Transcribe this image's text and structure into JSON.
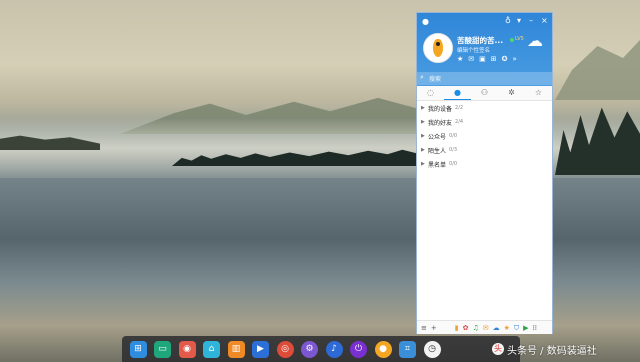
{
  "qq_panel": {
    "app_icon": "qq-penguin-icon",
    "window_controls": [
      {
        "icon": "skin-icon",
        "glyph": "♁"
      },
      {
        "icon": "dropdown-icon",
        "glyph": "▾"
      },
      {
        "icon": "minimize-icon",
        "glyph": "–"
      },
      {
        "icon": "close-icon",
        "glyph": "×"
      }
    ],
    "nickname": "苦酸甜的苦...",
    "level_badge": "LV5",
    "signature": "编辑个性签名",
    "header_icons": [
      {
        "icon": "favorite-icon",
        "glyph": "★"
      },
      {
        "icon": "mail-icon",
        "glyph": "✉"
      },
      {
        "icon": "wallet-icon",
        "glyph": "▣"
      },
      {
        "icon": "bag-icon",
        "glyph": "⊞"
      },
      {
        "icon": "star-icon",
        "glyph": "✪"
      },
      {
        "icon": "more-icon",
        "glyph": "»"
      }
    ],
    "weather_icon": "weather-cloudy-icon",
    "search": {
      "placeholder": "搜索",
      "icon": "search-icon"
    },
    "tabs": [
      {
        "icon": "message-icon",
        "glyph": "◌",
        "active": false
      },
      {
        "icon": "contacts-icon",
        "glyph": "●",
        "active": true
      },
      {
        "icon": "group-icon",
        "glyph": "⚇",
        "active": false
      },
      {
        "icon": "app-icon",
        "glyph": "✲",
        "active": false
      },
      {
        "icon": "favorites-icon",
        "glyph": "☆",
        "active": false
      }
    ],
    "groups": [
      {
        "name": "我的设备",
        "count": "2/2"
      },
      {
        "name": "我的好友",
        "count": "2/4"
      },
      {
        "name": "公众号",
        "count": "0/0"
      },
      {
        "name": "陌生人",
        "count": "0/3"
      },
      {
        "name": "黑名单",
        "count": "0/0"
      }
    ],
    "footer_icons": [
      {
        "icon": "menu-icon",
        "glyph": "≡",
        "color": "#555555"
      },
      {
        "icon": "add-icon",
        "glyph": "+",
        "color": "#555555"
      },
      {
        "icon": "file-icon",
        "glyph": "▮",
        "color": "#e8a23b"
      },
      {
        "icon": "game-icon",
        "glyph": "✿",
        "color": "#d94a4a"
      },
      {
        "icon": "music-icon",
        "glyph": "♫",
        "color": "#2aa14a"
      },
      {
        "icon": "mail-icon",
        "glyph": "✉",
        "color": "#e8a23b"
      },
      {
        "icon": "weiyun-icon",
        "glyph": "☁",
        "color": "#2f86d8"
      },
      {
        "icon": "qzone-icon",
        "glyph": "★",
        "color": "#e8a23b"
      },
      {
        "icon": "shield-icon",
        "glyph": "⛉",
        "color": "#2f86d8"
      },
      {
        "icon": "video-icon",
        "glyph": "▶",
        "color": "#2aa14a"
      },
      {
        "icon": "grid-icon",
        "glyph": "⁞⁞",
        "color": "#555555"
      }
    ]
  },
  "dock": {
    "apps": [
      {
        "icon": "launcher-icon",
        "glyph": "⊞",
        "color": "#2f8de0",
        "round": false
      },
      {
        "icon": "terminal-icon",
        "glyph": "▭",
        "color": "#1fa67a",
        "round": false
      },
      {
        "icon": "camera-icon",
        "glyph": "◉",
        "color": "#e35a4a",
        "round": false
      },
      {
        "icon": "store-icon",
        "glyph": "⌂",
        "color": "#2fb5d9",
        "round": false
      },
      {
        "icon": "files-icon",
        "glyph": "▥",
        "color": "#f08a24",
        "round": false
      },
      {
        "icon": "video-player-icon",
        "glyph": "▶",
        "color": "#2c6fd6",
        "round": false
      },
      {
        "icon": "chrome-icon",
        "glyph": "◎",
        "color": "#dd4b39",
        "round": true
      },
      {
        "icon": "settings-icon",
        "glyph": "⚙",
        "color": "#7b57d1",
        "round": true
      },
      {
        "icon": "music-icon",
        "glyph": "♪",
        "color": "#2d6ad6",
        "round": true
      },
      {
        "icon": "power-icon",
        "glyph": "⏻",
        "color": "#7a2fd0",
        "round": true
      },
      {
        "icon": "qq-icon",
        "glyph": "●",
        "color": "#f5a623",
        "round": true
      },
      {
        "icon": "screenshot-icon",
        "glyph": "⌗",
        "color": "#3b8fd8",
        "round": false
      },
      {
        "icon": "clock-icon",
        "glyph": "◷",
        "color": "#f2f2f2",
        "round": true
      }
    ]
  },
  "watermark": {
    "text": "头条号 / 数码装逼社",
    "icon": "toutiao-logo-icon"
  }
}
